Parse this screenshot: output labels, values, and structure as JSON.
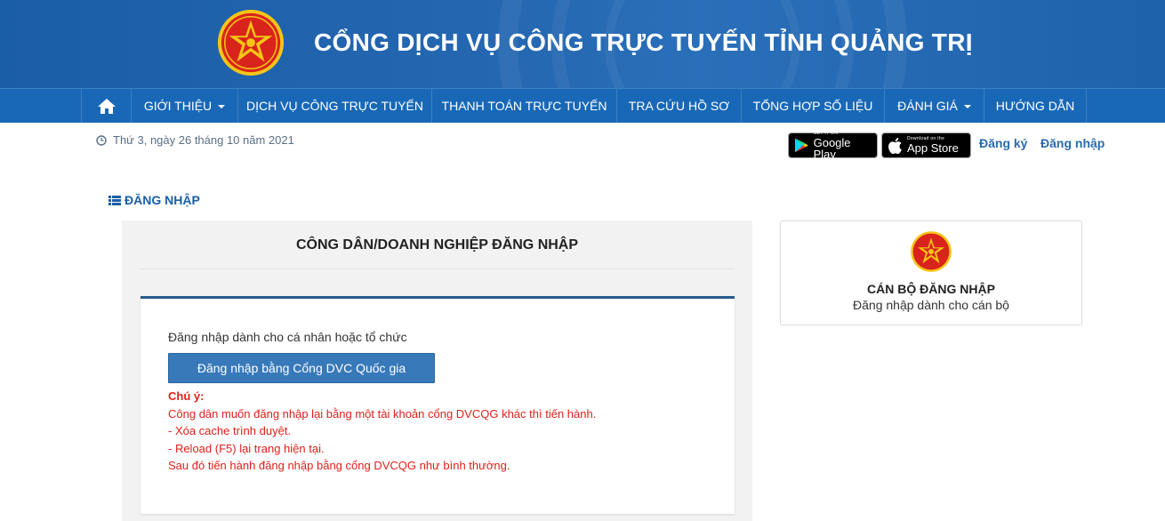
{
  "header": {
    "title": "CỔNG DỊCH VỤ CÔNG TRỰC TUYẾN TỈNH QUẢNG TRỊ",
    "emblem_icon": "national-emblem-icon",
    "background_color": "#1f63ad"
  },
  "nav": {
    "home_icon": "home-icon",
    "items": [
      {
        "label": "GIỚI THIỆU",
        "dropdown": true
      },
      {
        "label": "DỊCH VỤ CÔNG TRỰC TUYẾN",
        "dropdown": false
      },
      {
        "label": "THANH TOÁN TRỰC TUYẾN",
        "dropdown": false
      },
      {
        "label": "TRA CỨU HỒ SƠ",
        "dropdown": false
      },
      {
        "label": "TỔNG HỢP SỐ LIỆU",
        "dropdown": false
      },
      {
        "label": "ĐÁNH GIÁ",
        "dropdown": true
      },
      {
        "label": "HƯỚNG DẪN",
        "dropdown": false
      }
    ],
    "background_color": "#1868b7"
  },
  "subbar": {
    "date": "Thứ 3, ngày 26 tháng 10 năm 2021",
    "google_play": {
      "small": "GET IT ON",
      "big": "Google Play"
    },
    "app_store": {
      "small": "Download on the",
      "big": "App Store"
    },
    "register": "Đăng ký",
    "login": "Đăng nhập"
  },
  "section": {
    "heading": "ĐĂNG NHẬP"
  },
  "citizen_login": {
    "title": "CÔNG DÂN/DOANH NGHIỆP ĐĂNG NHẬP",
    "description": "Đăng nhập dành cho cá nhân hoặc tổ chức",
    "button": "Đăng nhập bằng Cổng DVC Quốc gia",
    "note_title": "Chú ý:",
    "note_lines": [
      "Công dân muốn đăng nhập lại bằng một tài khoản cổng DVCQG khác thì tiến hành.",
      "- Xóa cache trình duyệt.",
      "- Reload (F5) lại trang hiện tại.",
      "Sau đó tiến hành đăng nhập bằng cổng DVCQG như bình thường."
    ],
    "note_color": "#e0201b"
  },
  "staff_login": {
    "title": "CÁN BỘ ĐĂNG NHẬP",
    "subtitle": "Đăng nhập dành cho cán bộ"
  }
}
